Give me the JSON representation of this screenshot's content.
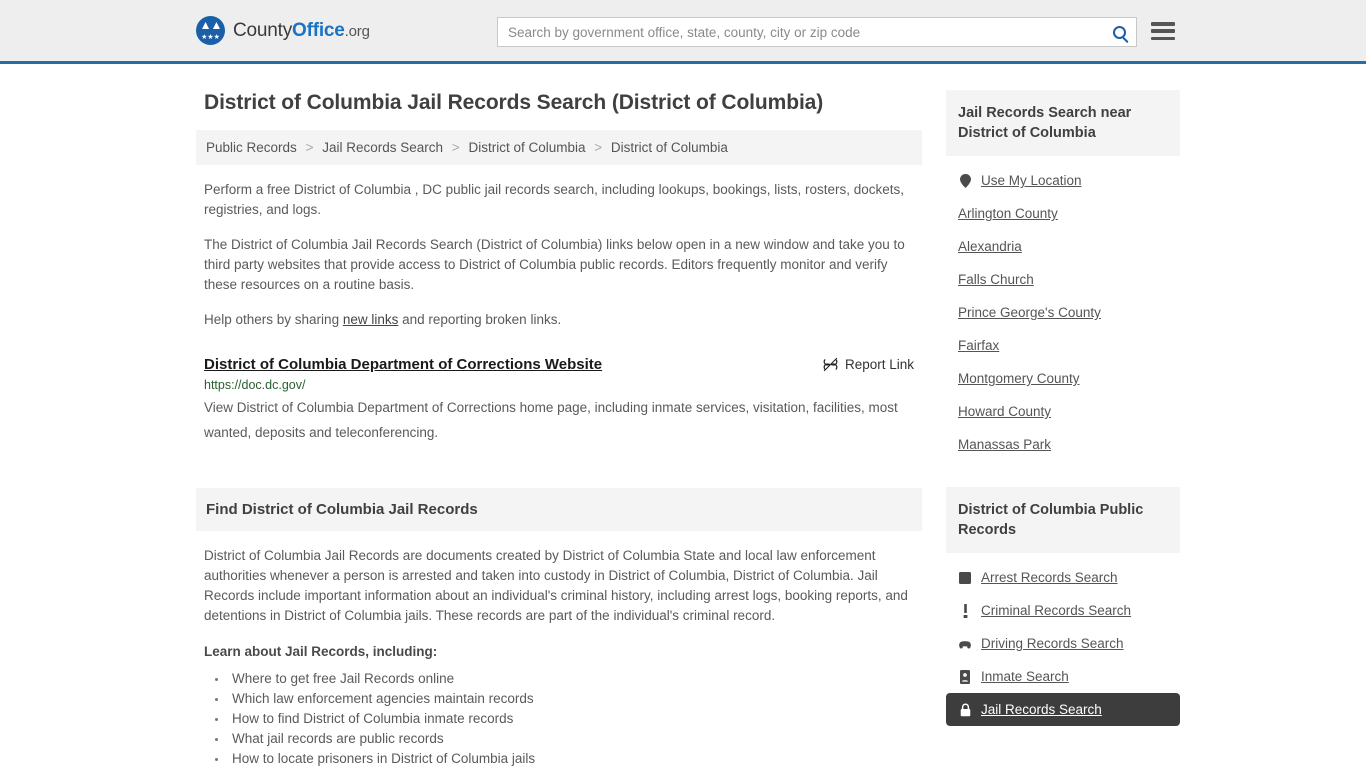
{
  "header": {
    "brand": {
      "part1": "County",
      "part2": "Office",
      "tld": ".org",
      "seal_icon": "eagle-seal-icon"
    },
    "search": {
      "placeholder": "Search by government office, state, county, city or zip code",
      "value": "",
      "search_icon": "search-icon"
    },
    "menu_icon": "hamburger-menu-icon",
    "accent_color": "#2a6aa6"
  },
  "main": {
    "title": "District of Columbia Jail Records Search (District of Columbia)",
    "breadcrumb": [
      "Public Records",
      "Jail Records Search",
      "District of Columbia",
      "District of Columbia"
    ],
    "breadcrumb_separator": ">",
    "paragraph1": "Perform a free District of Columbia , DC public jail records search, including lookups, bookings, lists, rosters, dockets, registries, and logs.",
    "paragraph2": "The District of Columbia Jail Records Search (District of Columbia) links below open in a new window and take you to third party websites that provide access to District of Columbia public records. Editors frequently monitor and verify these resources on a routine basis.",
    "paragraph3_before": "Help others by sharing ",
    "paragraph3_link": "new links",
    "paragraph3_after": " and reporting broken links.",
    "result": {
      "title": "District of Columbia Department of Corrections Website",
      "report_label": "Report Link",
      "report_icon": "broken-link-icon",
      "url": "https://doc.dc.gov/",
      "url_color": "#2a6130",
      "description": "View District of Columbia Department of Corrections home page, including inmate services, visitation, facilities, most wanted, deposits and teleconferencing."
    },
    "section_title": "Find District of Columbia Jail Records",
    "section_paragraph": "District of Columbia Jail Records are documents created by District of Columbia State and local law enforcement authorities whenever a person is arrested and taken into custody in District of Columbia, District of Columbia. Jail Records include important information about an individual's criminal history, including arrest logs, booking reports, and detentions in District of Columbia jails. These records are part of the individual's criminal record.",
    "learn_heading": "Learn about Jail Records, including:",
    "learn_items": [
      "Where to get free Jail Records online",
      "Which law enforcement agencies maintain records",
      "How to find District of Columbia inmate records",
      "What jail records are public records",
      "How to locate prisoners in District of Columbia jails"
    ]
  },
  "sidebar": {
    "nearby": {
      "heading": "Jail Records Search near District of Columbia",
      "items": [
        {
          "label": "Use My Location",
          "icon": "map-pin-icon"
        },
        {
          "label": "Arlington County",
          "icon": ""
        },
        {
          "label": "Alexandria",
          "icon": ""
        },
        {
          "label": "Falls Church",
          "icon": ""
        },
        {
          "label": "Prince George's County",
          "icon": ""
        },
        {
          "label": "Fairfax",
          "icon": ""
        },
        {
          "label": "Montgomery County",
          "icon": ""
        },
        {
          "label": "Howard County",
          "icon": ""
        },
        {
          "label": "Manassas Park",
          "icon": ""
        }
      ]
    },
    "public_records": {
      "heading": "District of Columbia Public Records",
      "items": [
        {
          "label": "Arrest Records Search",
          "icon": "fingerprint-icon",
          "active": false
        },
        {
          "label": "Criminal Records Search",
          "icon": "exclamation-icon",
          "active": false
        },
        {
          "label": "Driving Records Search",
          "icon": "car-icon",
          "active": false
        },
        {
          "label": "Inmate Search",
          "icon": "id-badge-icon",
          "active": false
        },
        {
          "label": "Jail Records Search",
          "icon": "lock-icon",
          "active": true
        }
      ],
      "active_bg": "#3d3d3d"
    }
  }
}
